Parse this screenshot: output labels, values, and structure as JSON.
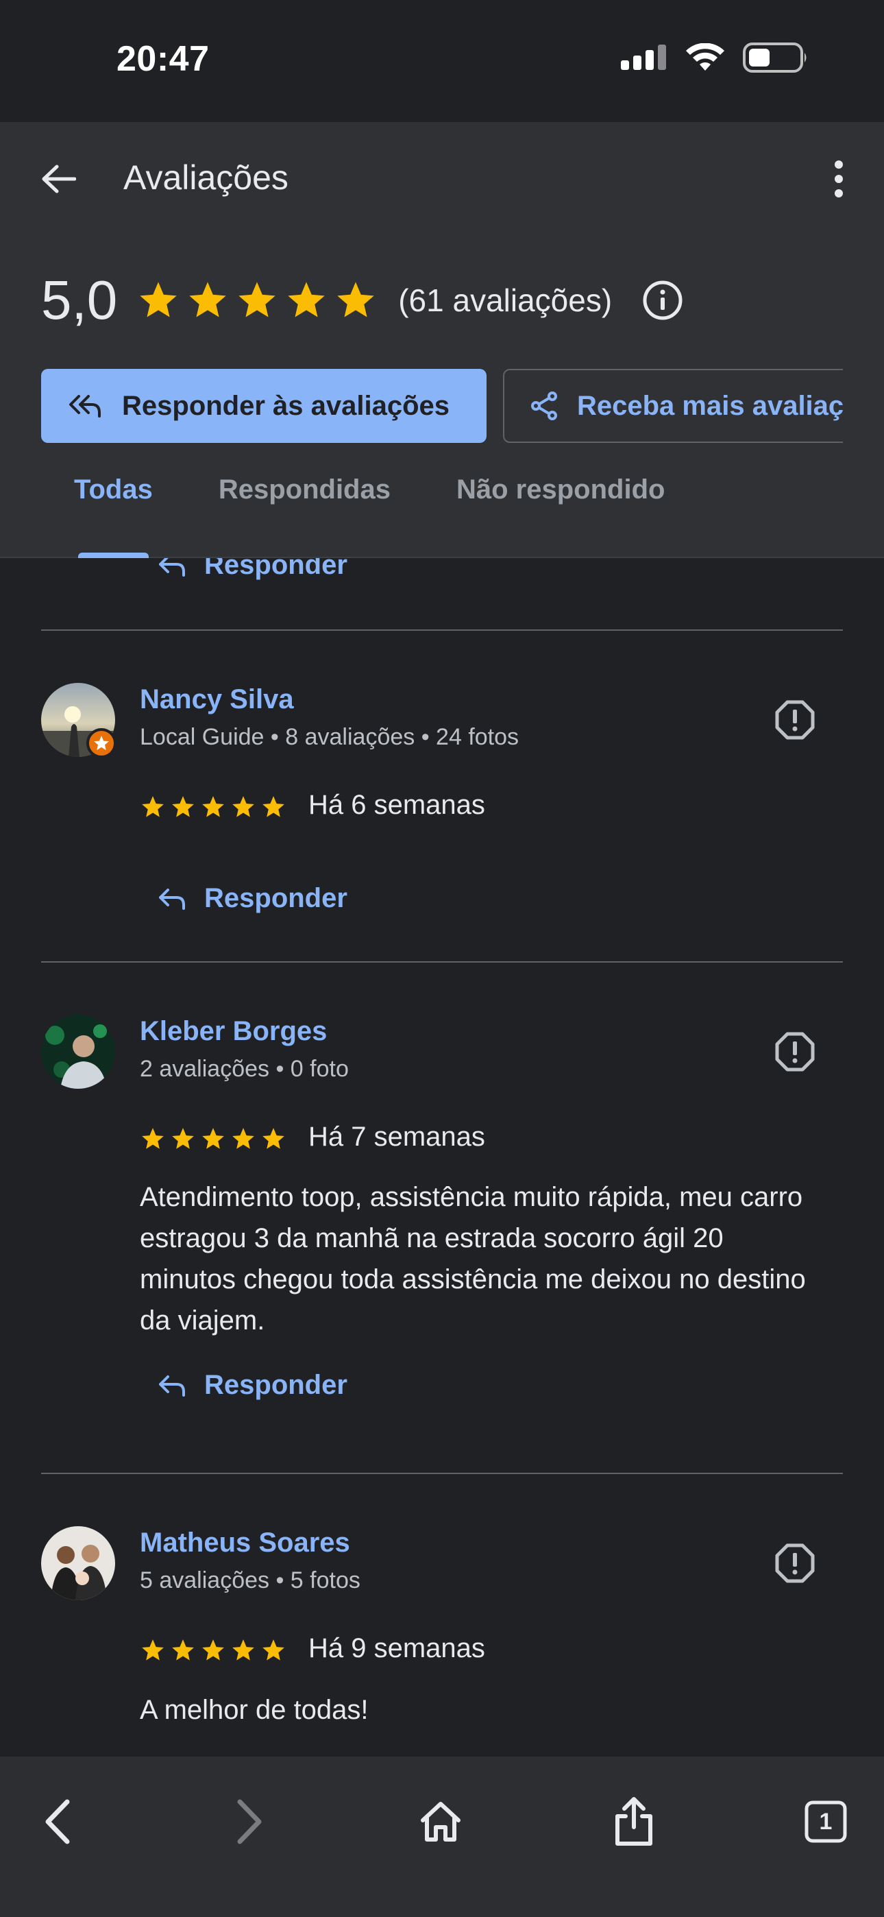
{
  "status_bar": {
    "time": "20:47"
  },
  "header": {
    "title": "Avaliações",
    "rating_score": "5,0",
    "rating_count": "(61 avaliações)",
    "star_color": "#fbbc04"
  },
  "actions": {
    "reply_reviews": "Responder às avaliações",
    "get_more": "Receba mais avaliações"
  },
  "tabs": [
    {
      "label": "Todas",
      "active": true
    },
    {
      "label": "Respondidas",
      "active": false
    },
    {
      "label": "Não respondido",
      "active": false
    }
  ],
  "reply_label": "Responder",
  "reviews": [
    {
      "name": "Nancy Silva",
      "meta": "Local Guide • 8 avaliações • 24 fotos",
      "rating": 5,
      "date": "Há 6 semanas",
      "text": ""
    },
    {
      "name": "Kleber Borges",
      "meta": "2 avaliações • 0 foto",
      "rating": 5,
      "date": "Há 7 semanas",
      "text": "Atendimento toop, assistência muito rápida, meu carro estragou 3 da manhã na estrada socorro ágil 20 minutos chegou toda assistência me deixou no destino da viajem."
    },
    {
      "name": "Matheus Soares",
      "meta": "5 avaliações • 5 fotos",
      "rating": 5,
      "date": "Há 9 semanas",
      "text": "A melhor de todas!"
    }
  ],
  "bottom_bar": {
    "tab_count": "1"
  },
  "colors": {
    "accent": "#8ab4f8",
    "background": "#202124",
    "header_bg": "#303134",
    "local_guide_badge": "#e8710a"
  }
}
